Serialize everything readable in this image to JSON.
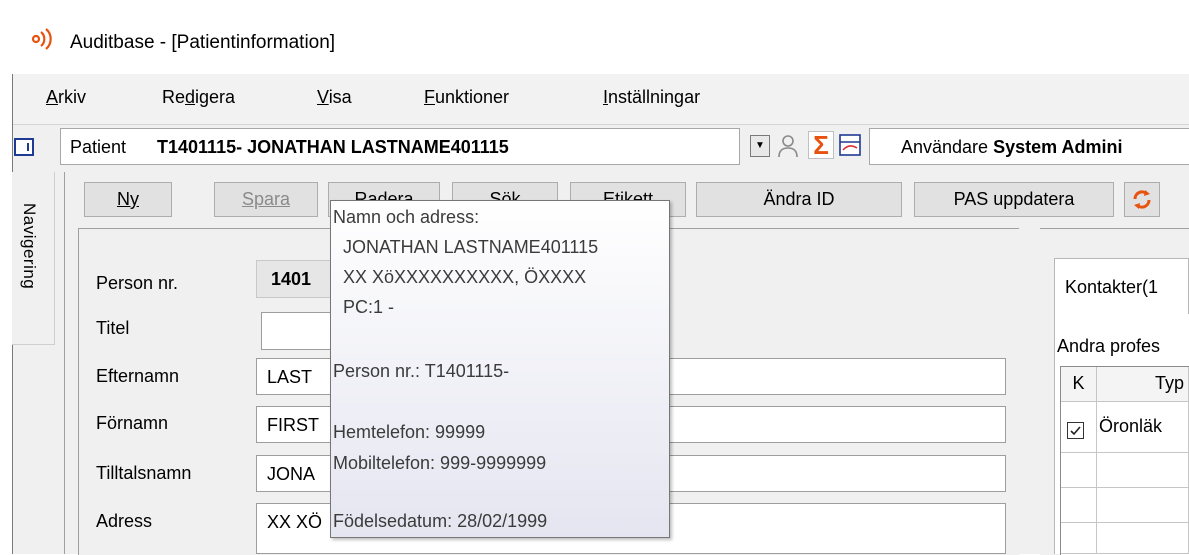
{
  "window": {
    "title": "Auditbase - [Patientinformation]"
  },
  "menu": [
    {
      "accel": "A",
      "rest": "rkiv"
    },
    {
      "accel": "",
      "pre": "Re",
      "mid": "d",
      "rest": "igera"
    },
    {
      "accel": "V",
      "rest": "isa"
    },
    {
      "accel": "F",
      "rest": "unktioner"
    },
    {
      "accel": "",
      "pre": "",
      "mid": "I",
      "rest": "nställningar"
    }
  ],
  "patient_bar": {
    "label": "Patient",
    "value": "T1401115- JONATHAN LASTNAME401115",
    "user_label": "Användare",
    "user_value": "System Admini"
  },
  "side_nav": {
    "label": "Navigering"
  },
  "toolbar": {
    "ny": "Ny",
    "spara": "Spara",
    "radera": "Radera",
    "sok": "Sök",
    "etikett": "Etikett",
    "andra_id": "Ändra ID",
    "pas": "PAS uppdatera"
  },
  "form": {
    "person_nr_label": "Person nr.",
    "person_nr_value": "1401",
    "titel_label": "Titel",
    "efternamn_label": "Efternamn",
    "efternamn_value": "LAST",
    "fornamn_label": "Förnamn",
    "fornamn_value": "FIRST",
    "tilltalsnamn_label": "Tilltalsnamn",
    "tilltalsnamn_value": "JONA",
    "adress_label": "Adress",
    "adress_value": "XX XÖ"
  },
  "right_panel": {
    "tab_label": "Kontakter(1",
    "caption": "Andra profes",
    "col_k": "K",
    "col_typ": "Typ",
    "row1_checked": true,
    "row1_typ": "Öronläk"
  },
  "tooltip": {
    "heading": "Namn och adress:",
    "name": "JONATHAN LASTNAME401115",
    "address": "XX XöXXXXXXXXXX, ÖXXXX",
    "pc": "PC:1  -",
    "person_nr": "Person nr.: T1401115-",
    "hemtelefon": "Hemtelefon: 99999",
    "mobiltelefon": "Mobiltelefon: 999-9999999",
    "fodelsedatum": "Födelsedatum: 28/02/1999"
  },
  "colors": {
    "accent_orange": "#e8520f",
    "icon_blue": "#1f3a93"
  }
}
